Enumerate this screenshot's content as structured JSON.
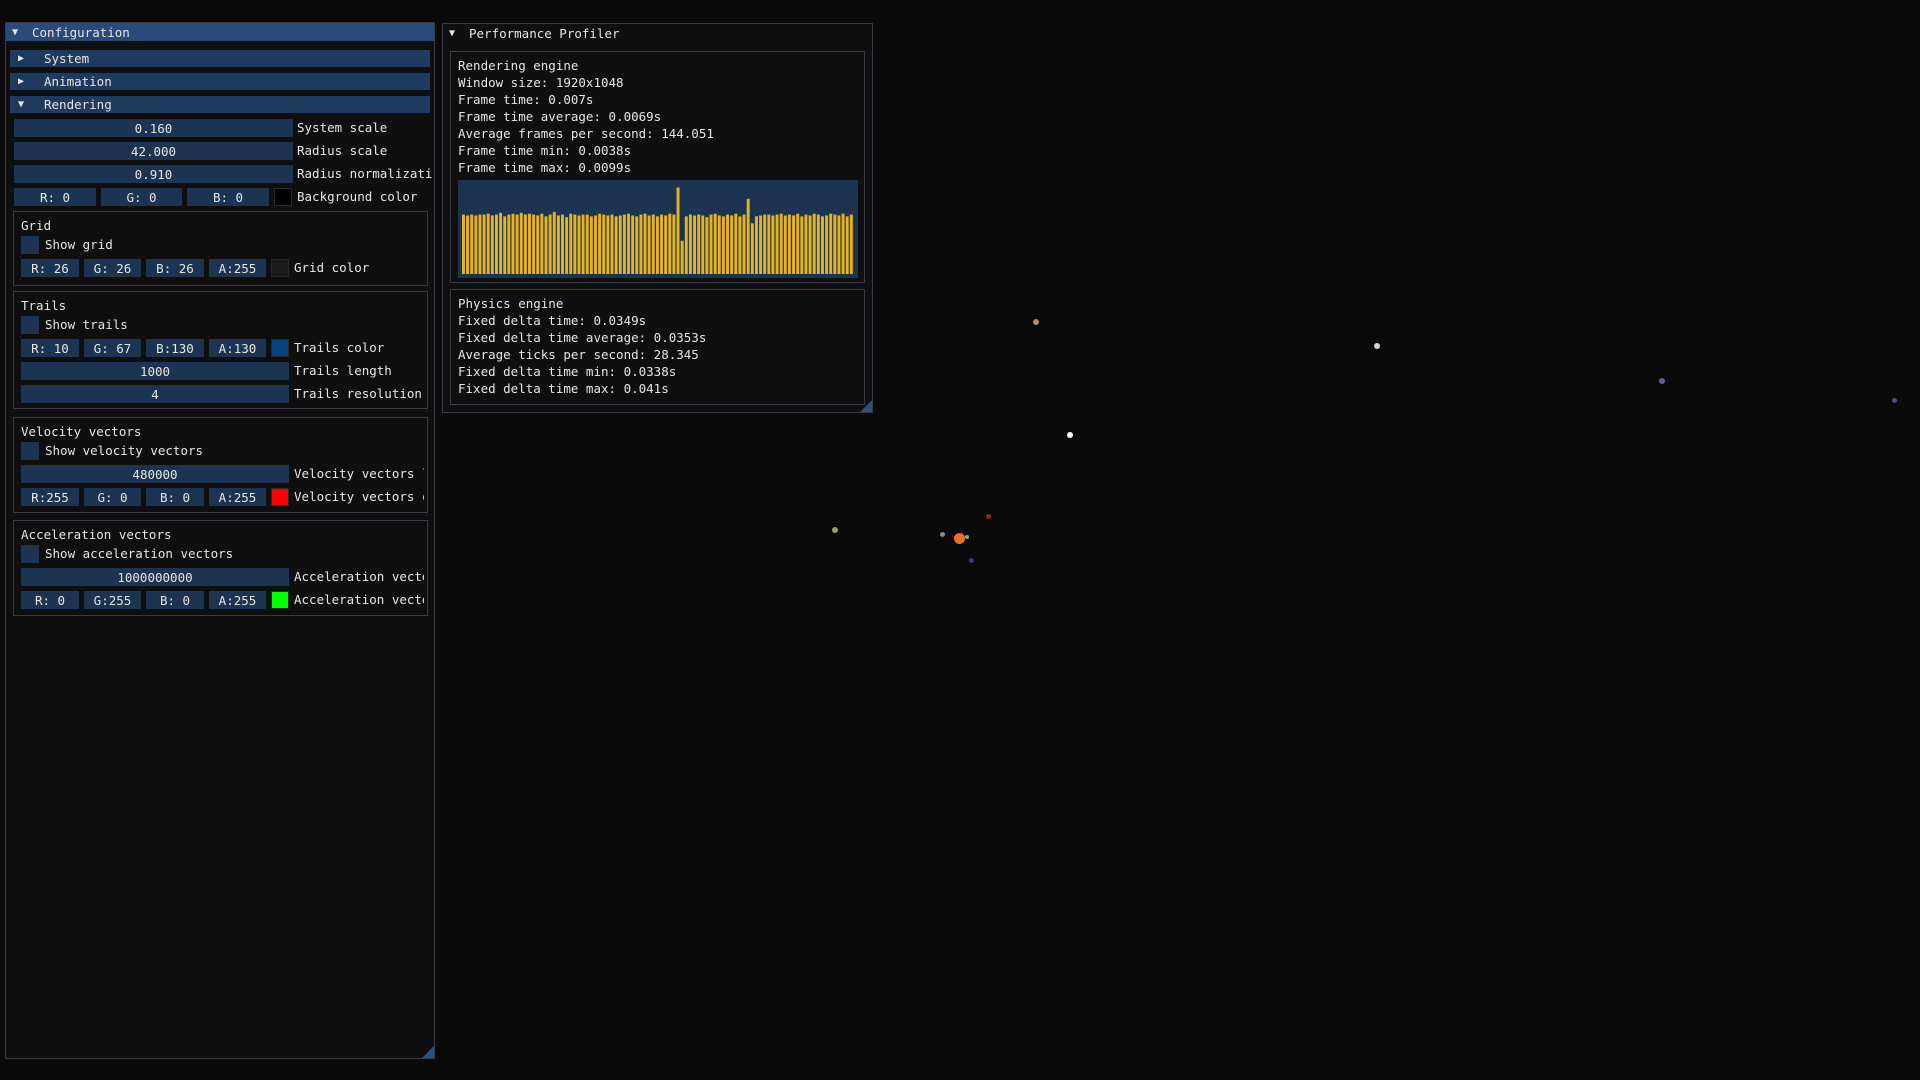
{
  "config": {
    "title": "Configuration",
    "sections": {
      "system": "System",
      "animation": "Animation",
      "rendering": "Rendering"
    },
    "system_scale": {
      "value": "0.160",
      "label": "System scale"
    },
    "radius_scale": {
      "value": "42.000",
      "label": "Radius scale"
    },
    "radius_normalization": {
      "value": "0.910",
      "label": "Radius normalization"
    },
    "background": {
      "r": "R:  0",
      "g": "G:  0",
      "b": "B:  0",
      "label": "Background color",
      "color": "#000000"
    },
    "grid": {
      "title": "Grid",
      "show_label": "Show grid",
      "r": "R: 26",
      "g": "G: 26",
      "b": "B: 26",
      "a": "A:255",
      "color_label": "Grid color",
      "color": "#1a1a1a"
    },
    "trails": {
      "title": "Trails",
      "show_label": "Show trails",
      "r": "R: 10",
      "g": "G: 67",
      "b": "B:130",
      "a": "A:130",
      "color_label": "Trails color",
      "color": "#0a4382",
      "length_value": "1000",
      "length_label": "Trails length",
      "resolution_value": "4",
      "resolution_label": "Trails resolution"
    },
    "velocity": {
      "title": "Velocity vectors",
      "show_label": "Show velocity vectors",
      "length_value": "480000",
      "length_label": "Velocity vectors length",
      "r": "R:255",
      "g": "G:  0",
      "b": "B:  0",
      "a": "A:255",
      "color_label": "Velocity vectors color",
      "color": "#ff0000"
    },
    "acceleration": {
      "title": "Acceleration vectors",
      "show_label": "Show acceleration vectors",
      "length_value": "1000000000",
      "length_label": "Acceleration vectors length",
      "r": "R:  0",
      "g": "G:255",
      "b": "B:  0",
      "a": "A:255",
      "color_label": "Acceleration vectors color",
      "color": "#00ff00"
    }
  },
  "profiler": {
    "title": "Performance Profiler",
    "rendering": {
      "title": "Rendering engine",
      "lines": [
        "Window size: 1920x1048",
        "Frame time: 0.007s",
        "Frame time average: 0.0069s",
        "Average frames per second: 144.051",
        "Frame time min: 0.0038s",
        "Frame time max: 0.0099s"
      ]
    },
    "histogram_values": [
      0.0068,
      0.0067,
      0.0068,
      0.0067,
      0.0068,
      0.0068,
      0.0069,
      0.0067,
      0.0068,
      0.007,
      0.0066,
      0.0068,
      0.0069,
      0.0068,
      0.007,
      0.0068,
      0.0069,
      0.0068,
      0.0067,
      0.0069,
      0.0066,
      0.0068,
      0.0071,
      0.0067,
      0.0068,
      0.0065,
      0.0069,
      0.0068,
      0.0067,
      0.0068,
      0.0068,
      0.0066,
      0.0067,
      0.0069,
      0.0068,
      0.0067,
      0.0068,
      0.0066,
      0.0067,
      0.0068,
      0.0069,
      0.0067,
      0.0066,
      0.0068,
      0.0069,
      0.0067,
      0.0068,
      0.0066,
      0.0068,
      0.0067,
      0.0069,
      0.0068,
      0.0099,
      0.0038,
      0.0066,
      0.0068,
      0.0067,
      0.0068,
      0.0067,
      0.0065,
      0.0068,
      0.0069,
      0.0067,
      0.0066,
      0.0068,
      0.0067,
      0.0069,
      0.0066,
      0.0068,
      0.0086,
      0.0058,
      0.0066,
      0.0067,
      0.0068,
      0.0068,
      0.0067,
      0.0068,
      0.0069,
      0.0067,
      0.0068,
      0.0067,
      0.0069,
      0.0066,
      0.0068,
      0.0067,
      0.0069,
      0.0068,
      0.0066,
      0.0067,
      0.0069,
      0.0068,
      0.0067,
      0.0069,
      0.0066,
      0.0068
    ],
    "histogram_max": 0.0103,
    "histogram_bar_color": "#e6b41e",
    "histogram_bg": "#1d3352",
    "physics": {
      "title": "Physics engine",
      "lines": [
        "Fixed delta time: 0.0349s",
        "Fixed delta time average: 0.0353s",
        "Average ticks per second: 28.345",
        "Fixed delta time min: 0.0338s",
        "Fixed delta time max: 0.041s"
      ]
    }
  },
  "bodies": [
    {
      "color": "#f26a2c"
    },
    {
      "color": "#b88a6a"
    },
    {
      "color": "#9a9f6a"
    },
    {
      "color": "#ffffff"
    },
    {
      "color": "#ccd8e0"
    },
    {
      "color": "#6a58a8"
    },
    {
      "color": "#5a4a88"
    },
    {
      "color": "#a02018"
    },
    {
      "color": "#8a8a8a"
    },
    {
      "color": "#7ab48a"
    },
    {
      "color": "#3a3a88"
    }
  ]
}
